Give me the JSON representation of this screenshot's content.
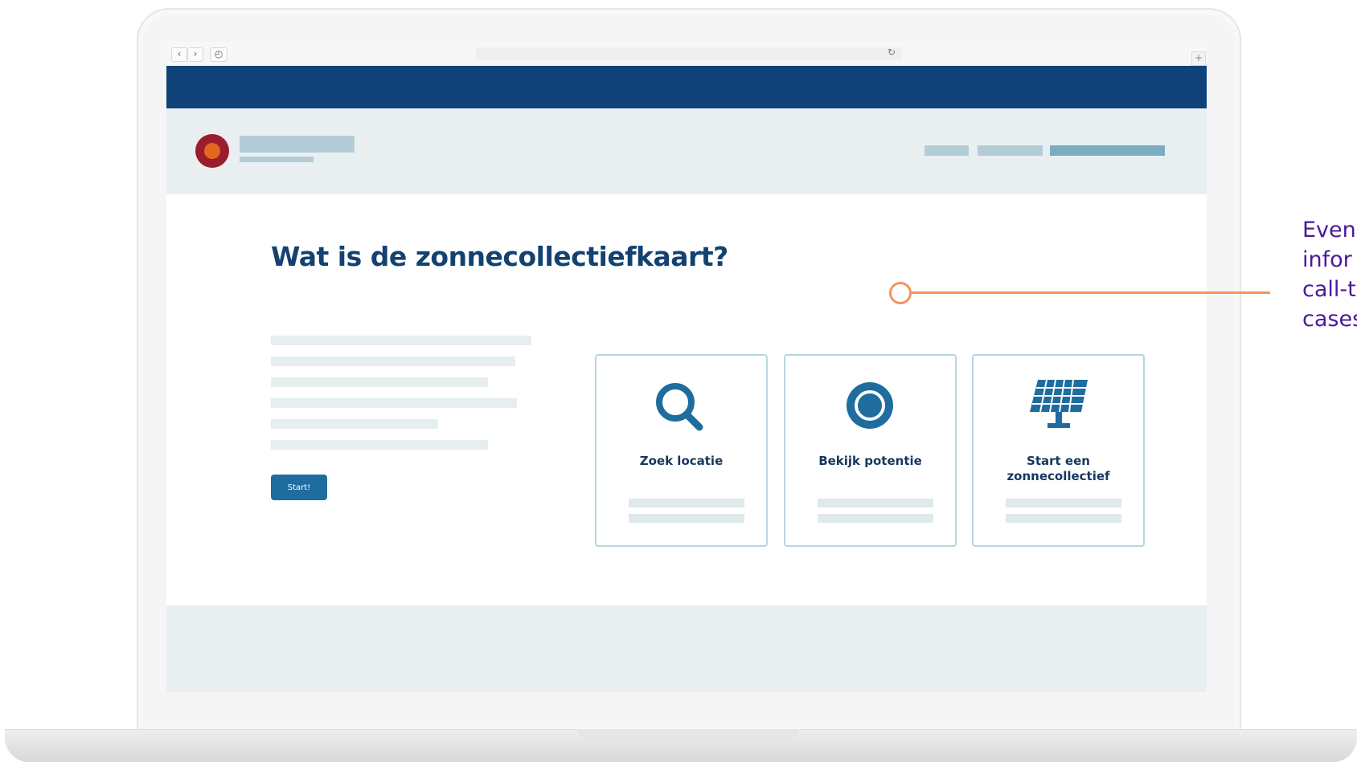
{
  "browser": {
    "back_icon": "chevron-left",
    "forward_icon": "chevron-right",
    "history_icon": "clock",
    "back_glyph": "‹",
    "forward_glyph": "›",
    "history_glyph": "◴",
    "reload_glyph": "↻",
    "new_tab_glyph": "+"
  },
  "colors": {
    "top_bar": "#10427a",
    "header_bg": "#e9eff1",
    "title": "#134271",
    "accent_button": "#1f6c9e",
    "card_border": "#b6d6de",
    "annotation": "#f2955f",
    "annotation_text": "#4a1a9c",
    "logo_outer": "#9b1c2b",
    "logo_inner": "#e5661f"
  },
  "page": {
    "title": "Wat is de zonnecollectiefkaart?",
    "start_button": "Start!"
  },
  "cards": [
    {
      "label": "Zoek locatie",
      "icon": "search-icon"
    },
    {
      "label": "Bekijk potentie",
      "icon": "target-circle-icon"
    },
    {
      "label": "Start een zonnecollectief",
      "label_line1": "Start een",
      "label_line2": "zonnecollectief",
      "icon": "solar-panel-icon"
    }
  ],
  "annotation": {
    "text_lines": [
      "Even",
      "infor",
      "call-t",
      "cases"
    ]
  }
}
